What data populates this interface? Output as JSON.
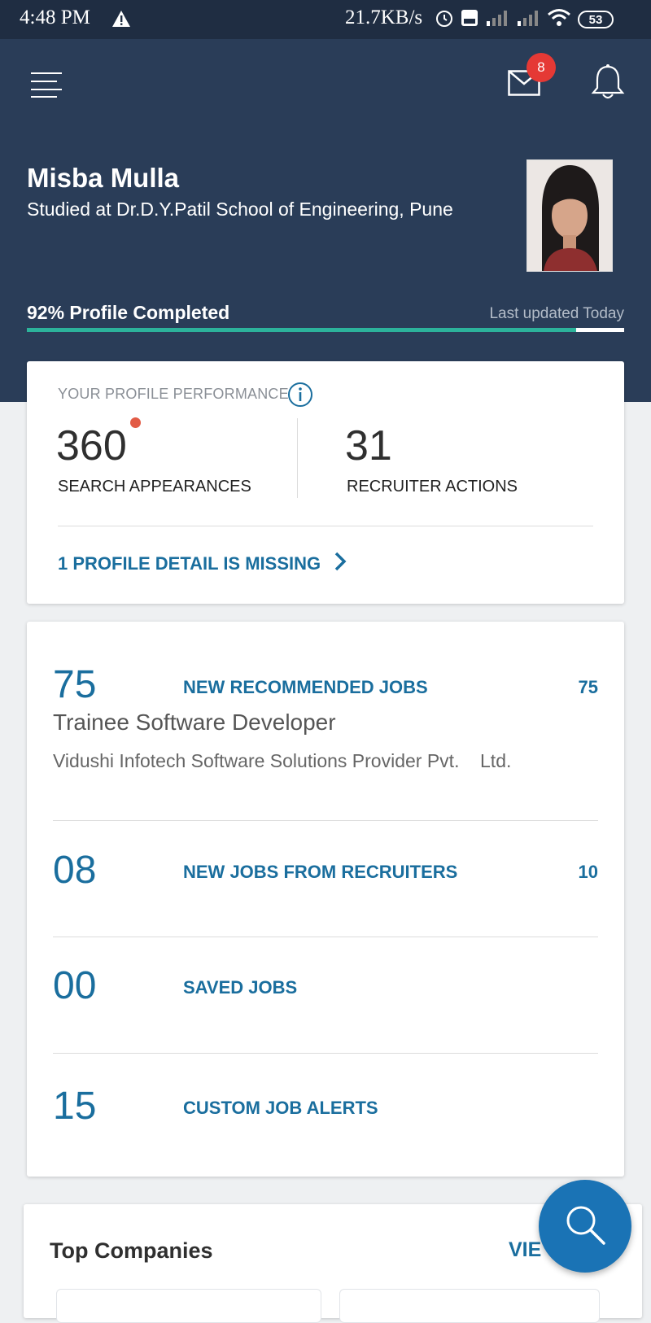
{
  "status_bar": {
    "time": "4:48 PM",
    "net_speed": "21.7KB/s",
    "battery": "53"
  },
  "header": {
    "mail_badge": "8",
    "name": "Misba Mulla",
    "education": "Studied at Dr.D.Y.Patil School of Engineering, Pune",
    "completion_label": "92% Profile Completed",
    "completion_percent": 92,
    "last_updated": "Last updated Today"
  },
  "performance": {
    "title": "YOUR PROFILE PERFORMANCE",
    "search_appearances": "360",
    "search_appearances_label": "SEARCH APPEARANCES",
    "recruiter_actions": "31",
    "recruiter_actions_label": "RECRUITER ACTIONS",
    "missing_link": "1 PROFILE DETAIL IS MISSING"
  },
  "jobs": [
    {
      "number": "75",
      "label": "NEW RECOMMENDED JOBS",
      "count": "75",
      "title": "Trainee Software Developer",
      "company": "Vidushi Infotech Software Solutions Provider Pvt.    Ltd."
    },
    {
      "number": "08",
      "label": "NEW JOBS FROM RECRUITERS",
      "count": "10"
    },
    {
      "number": "00",
      "label": "SAVED JOBS"
    },
    {
      "number": "15",
      "label": "CUSTOM JOB ALERTS"
    }
  ],
  "companies": {
    "title": "Top Companies",
    "view_link": "VIE"
  },
  "colors": {
    "header_bg": "#2a3d58",
    "accent_blue": "#1a6e9e",
    "progress_green": "#2cb39b",
    "badge_red": "#e53935",
    "fab_blue": "#1a73b5"
  },
  "icons": [
    "menu-icon",
    "mail-icon",
    "bell-icon",
    "info-icon",
    "chevron-right-icon",
    "search-icon",
    "warning-icon",
    "alarm-icon",
    "signal-icon",
    "wifi-icon"
  ]
}
